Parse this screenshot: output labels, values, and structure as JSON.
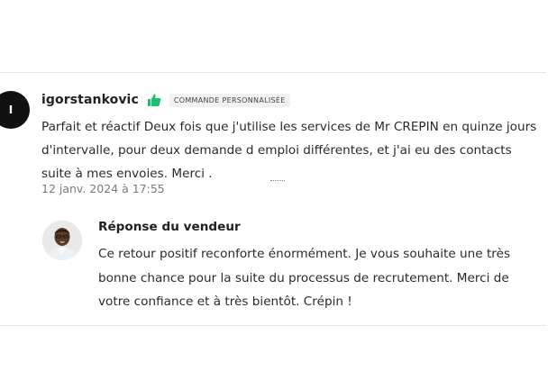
{
  "review": {
    "avatar_initial": "I",
    "username": "igorstankovic",
    "icon": "thumbs-up-icon",
    "badge": "COMMANDE PERSONNALISÉE",
    "text": "Parfait et réactif Deux fois que j'utilise les services de Mr CREPIN en quinze jours d'intervalle, pour deux demande d emploi différentes, et j'ai eu des contacts suite à mes envoies. Merci .",
    "date": "12 janv. 2024 à 17:55"
  },
  "seller_response": {
    "title": "Réponse du vendeur",
    "text": "Ce retour positif reconforte énormément. Je vous souhaite une très bonne chance pour la suite du processus de recrutement. Merci de votre confiance et à très bientôt. Crépin !"
  },
  "colors": {
    "thumb_icon": "#1dbf73",
    "avatar_bg": "#111111",
    "badge_bg": "#f1f1f1"
  }
}
